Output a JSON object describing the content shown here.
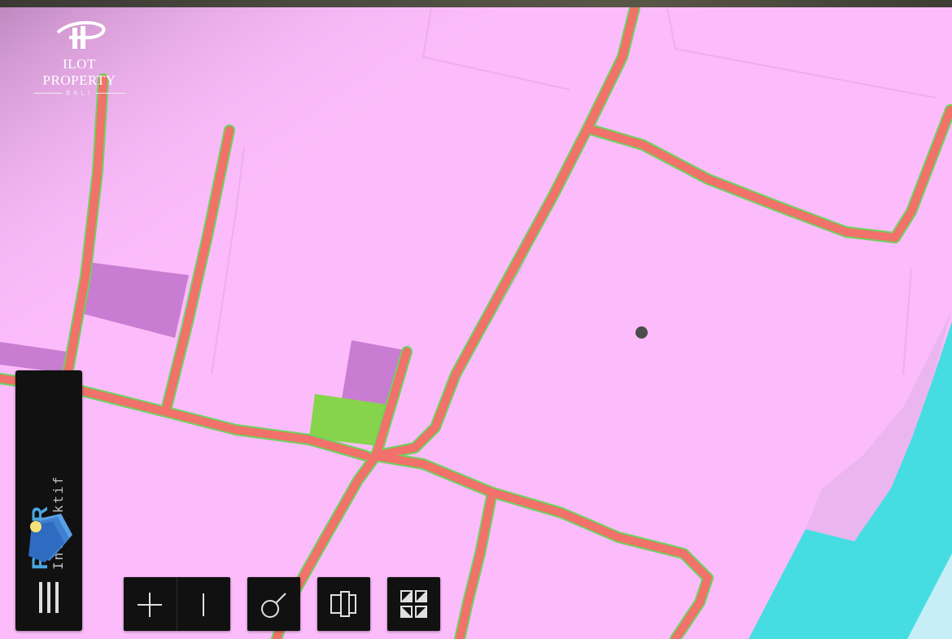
{
  "brand": {
    "name": "ILOT PROPERTY",
    "sub": "BALI",
    "logo_icon": "ip-monogram-icon"
  },
  "panel": {
    "title": "RDTR",
    "subtitle": "Interaktif",
    "logo_icon": "layers-icon",
    "menu_icon": "menu-bars-icon"
  },
  "toolbar": {
    "buttons": [
      {
        "name": "zoom-in-button",
        "icon": "plus-icon"
      },
      {
        "name": "zoom-out-button",
        "icon": "minus-icon"
      },
      {
        "name": "measure-button",
        "icon": "measure-icon"
      },
      {
        "name": "compare-button",
        "icon": "compare-layers-icon"
      },
      {
        "name": "basemap-button",
        "icon": "basemap-grid-icon"
      }
    ]
  },
  "map": {
    "zone_colors": {
      "residential": "#fcbcfb",
      "commercial": "#c97dd2",
      "green_space": "#86d44b",
      "water": "#45dde2",
      "road": "#f2716a",
      "road_edge": "#6fd15f",
      "coastal": "#ebb6ef"
    },
    "location_marker": "location-dot"
  }
}
